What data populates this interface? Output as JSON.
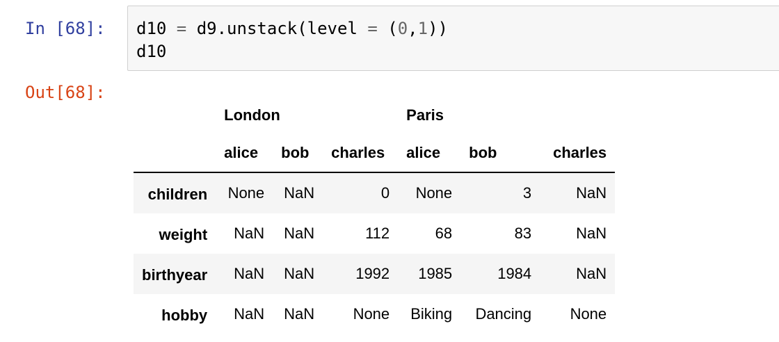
{
  "cell": {
    "in_prompt": "In [68]:",
    "out_prompt": "Out[68]:",
    "code": {
      "l1_a": "d10 ",
      "l1_eq": "=",
      "l1_b": " d9.unstack(level ",
      "l1_eq2": "=",
      "l1_c": " (",
      "l1_n0": "0",
      "l1_comma": ",",
      "l1_n1": "1",
      "l1_d": "))",
      "l2": "d10"
    }
  },
  "dataframe": {
    "level0": [
      "London",
      "Paris"
    ],
    "level1": [
      "alice",
      "bob",
      "charles",
      "alice",
      "bob",
      "charles"
    ],
    "rows": [
      {
        "index": "children",
        "values": [
          "None",
          "NaN",
          "0",
          "None",
          "3",
          "NaN"
        ]
      },
      {
        "index": "weight",
        "values": [
          "NaN",
          "NaN",
          "112",
          "68",
          "83",
          "NaN"
        ]
      },
      {
        "index": "birthyear",
        "values": [
          "NaN",
          "NaN",
          "1992",
          "1985",
          "1984",
          "NaN"
        ]
      },
      {
        "index": "hobby",
        "values": [
          "NaN",
          "NaN",
          "None",
          "Biking",
          "Dancing",
          "None"
        ]
      }
    ]
  }
}
